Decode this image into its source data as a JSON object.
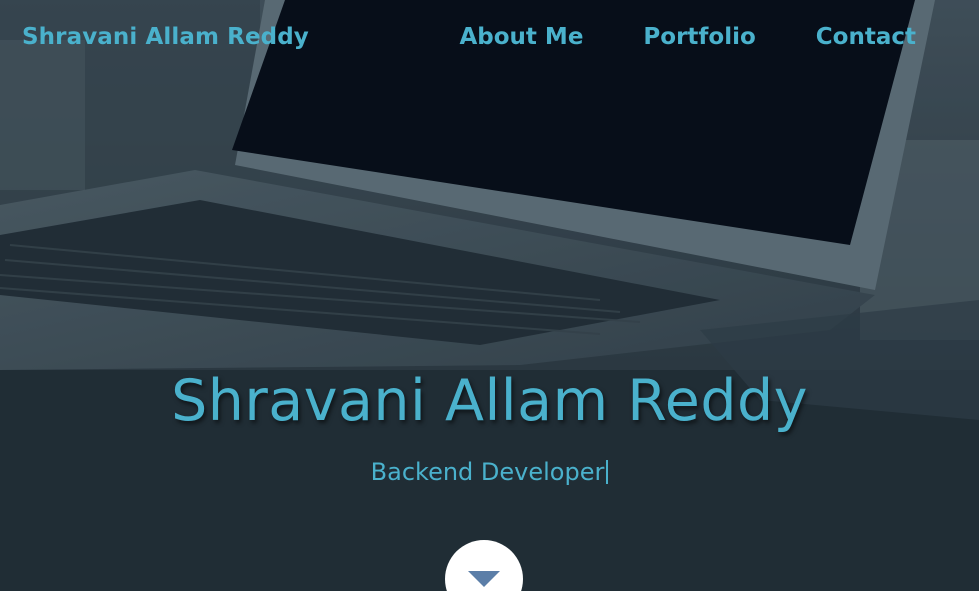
{
  "header": {
    "brand": "Shravani Allam Reddy",
    "nav": [
      {
        "label": "About Me"
      },
      {
        "label": "Portfolio"
      },
      {
        "label": "Contact"
      }
    ]
  },
  "hero": {
    "title": "Shravani Allam Reddy",
    "subtitle": "Backend Developer"
  },
  "icons": {
    "scroll": "chevron-down-icon"
  },
  "colors": {
    "accent": "#4ab1cc",
    "button_bg": "#ffffff",
    "arrow": "#5b7ea8"
  }
}
